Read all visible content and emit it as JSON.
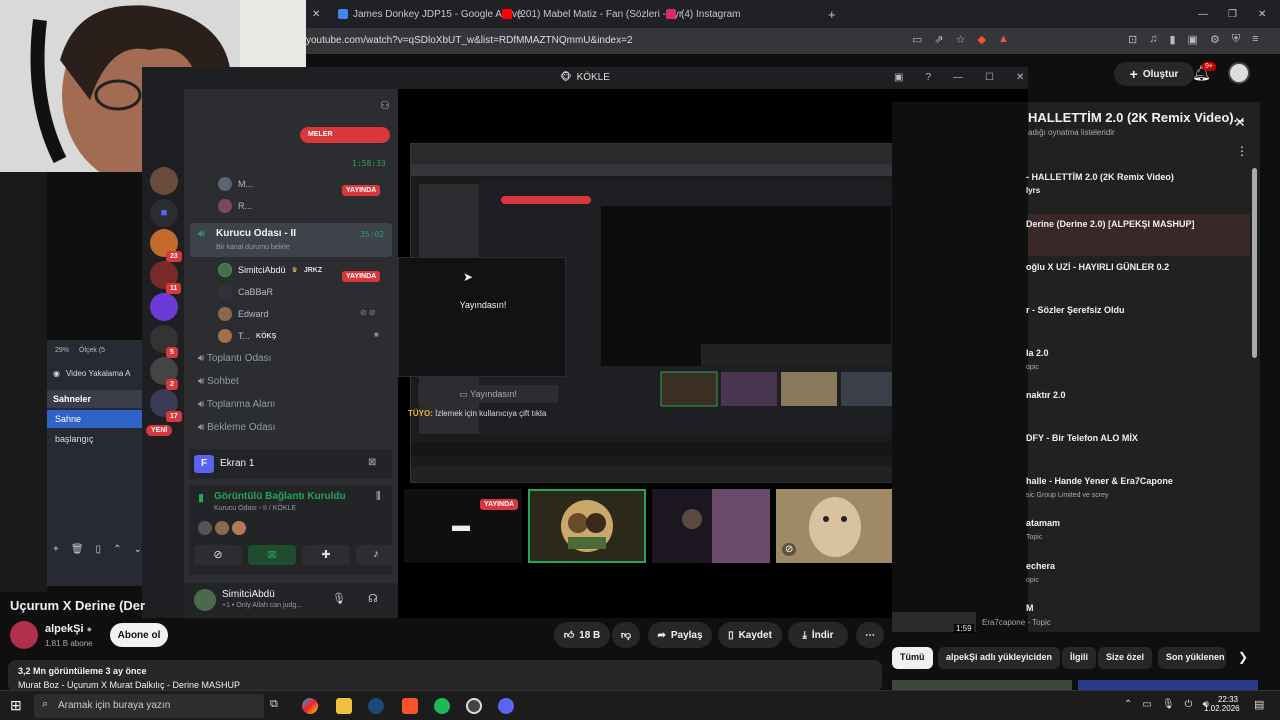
{
  "browser": {
    "tabs": [
      {
        "label": "James Donkey JDP15 - Google Alışve",
        "color": "#4285f4"
      },
      {
        "label": "(201) Mabel Matiz - Fan (Sözleri - Lyr",
        "color": "#ff0000"
      },
      {
        "label": "(4) Instagram",
        "color": "#d62976"
      }
    ],
    "url": "youtube.com/watch?v=qSDloXbUT_w&list=RDfMMAZTNQmmU&index=2"
  },
  "youtube": {
    "create_label": "Oluştur",
    "notif_count": "9+",
    "video_title": "Uçurum X Derine (Der",
    "channel": "alpekŞi",
    "subscribers": "1,81 B abone",
    "subscribe_label": "Abone ol",
    "likes": "18 B",
    "share_label": "Paylaş",
    "save_label": "Kaydet",
    "download_label": "İndir",
    "views": "3,2 Mn görüntüleme  3 ay önce",
    "description": "Murat Boz - Uçurum X Murat Dalkılıç - Derine MASHUP",
    "chips": [
      "Tümü",
      "alpekŞi adlı yükleyiciden",
      "İlgili",
      "Size özel",
      "Son yüklenen"
    ]
  },
  "playlist": {
    "title": "HALLETTİM 2.0 (2K Remix Video)...",
    "subtitle": "adığı oynatma listeleridir",
    "items": [
      {
        "title": "- HALLETTİM 2.0 (2K Remix Video)",
        "sub": "lyrs"
      },
      {
        "title": "Derine (Derine 2.0) [ALPEKŞI MASHUP]",
        "sub": ""
      },
      {
        "title": "oğlu X UZİ - HAYIRLI GÜNLER 0.2",
        "sub": ""
      },
      {
        "title": "r - Sözler Şerefsiz Oldu",
        "sub": ""
      },
      {
        "title": "la 2.0",
        "sub": "opic"
      },
      {
        "title": "naktır 2.0",
        "sub": ""
      },
      {
        "title": "DFY - Bir Telefon ALO MİX",
        "sub": ""
      },
      {
        "title": "halle - Hande Yener & Era7Capone",
        "sub": "sic Group Limited ve screy"
      },
      {
        "title": "atamam",
        "sub": "Topic"
      },
      {
        "title": "echera",
        "sub": "opic"
      },
      {
        "title": "M",
        "sub": ""
      }
    ],
    "last_duration": "1:59",
    "last_channel": "Era7capone - Topic"
  },
  "discord": {
    "window_title": "KÖKLE",
    "stream_banner": "MELER",
    "timer1": "1:58:33",
    "room": "Kurucu Odası - II",
    "room_timer": "35:02",
    "room_status": "Bir kanal durumu belirle",
    "live": "YAYINDA",
    "users": [
      "M...",
      "R...",
      "SimitciAbdü",
      "CaBBaR",
      "Edward",
      "T..."
    ],
    "user_tags": {
      "simitci": "JRKZ",
      "t": "KÖKŞ"
    },
    "channels": [
      "Toplantı Odası",
      "Sohbet",
      "Toplanma Alanı",
      "Bekleme Odası"
    ],
    "new_label": "YENİ",
    "screen_label": "Ekran 1",
    "connected": "Görüntülü Bağlantı Kuruldu",
    "connected_sub": "Kurucu Odası - II / KÖKLE",
    "self_name": "SimitciAbdü",
    "self_status": "+1 • Only Allah can judg...",
    "you_are_live": "Yayındasın!",
    "you_are_live_btn": "Yayındasın!",
    "tip_prefix": "TÜYO:",
    "tip": "İzlemek için kullanıcıya çift tıkla",
    "server_badges": [
      "23",
      "11",
      "5",
      "2",
      "17"
    ]
  },
  "obs": {
    "zoom": "29%",
    "scale": "Ölçek (5",
    "capture": "Video Yakalama A",
    "scenes_title": "Sahneler",
    "scenes": [
      "Sahne",
      "başlangıç"
    ]
  },
  "taskbar": {
    "search_placeholder": "Aramak için buraya yazın",
    "time": "22:33",
    "date": "1.02.2026"
  }
}
